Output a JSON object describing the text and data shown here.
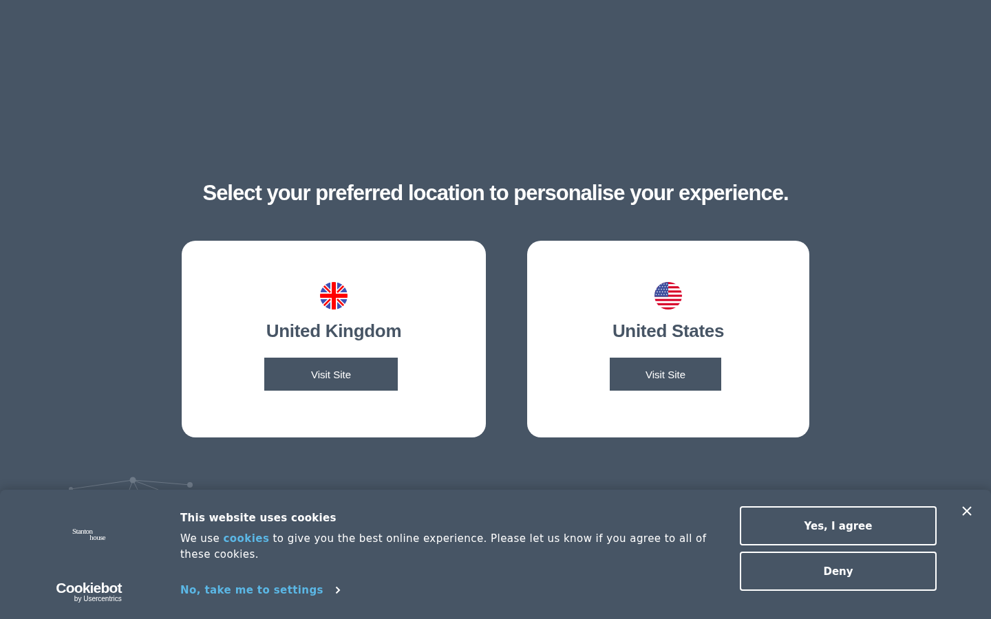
{
  "heading": "Select your preferred location to personalise your experience.",
  "locations": [
    {
      "kind": "uk",
      "country": "United Kingdom",
      "button": "Visit Site"
    },
    {
      "kind": "us",
      "country": "United States",
      "button": "Visit Site"
    }
  ],
  "cookie_banner": {
    "brand_logo": {
      "line_1": "Stanton",
      "line_2": "house"
    },
    "provider_logo": {
      "name": "Cookiebot",
      "byline": "by Usercentrics"
    },
    "title": "This website uses cookies",
    "body": {
      "before_link": "We use ",
      "link": "cookies",
      "after_link": " to give you the best online experience. Please let us know if you agree to all of these cookies."
    },
    "settings_link": "No, take me to settings",
    "buttons": [
      "Yes, I agree",
      "Deny"
    ]
  }
}
